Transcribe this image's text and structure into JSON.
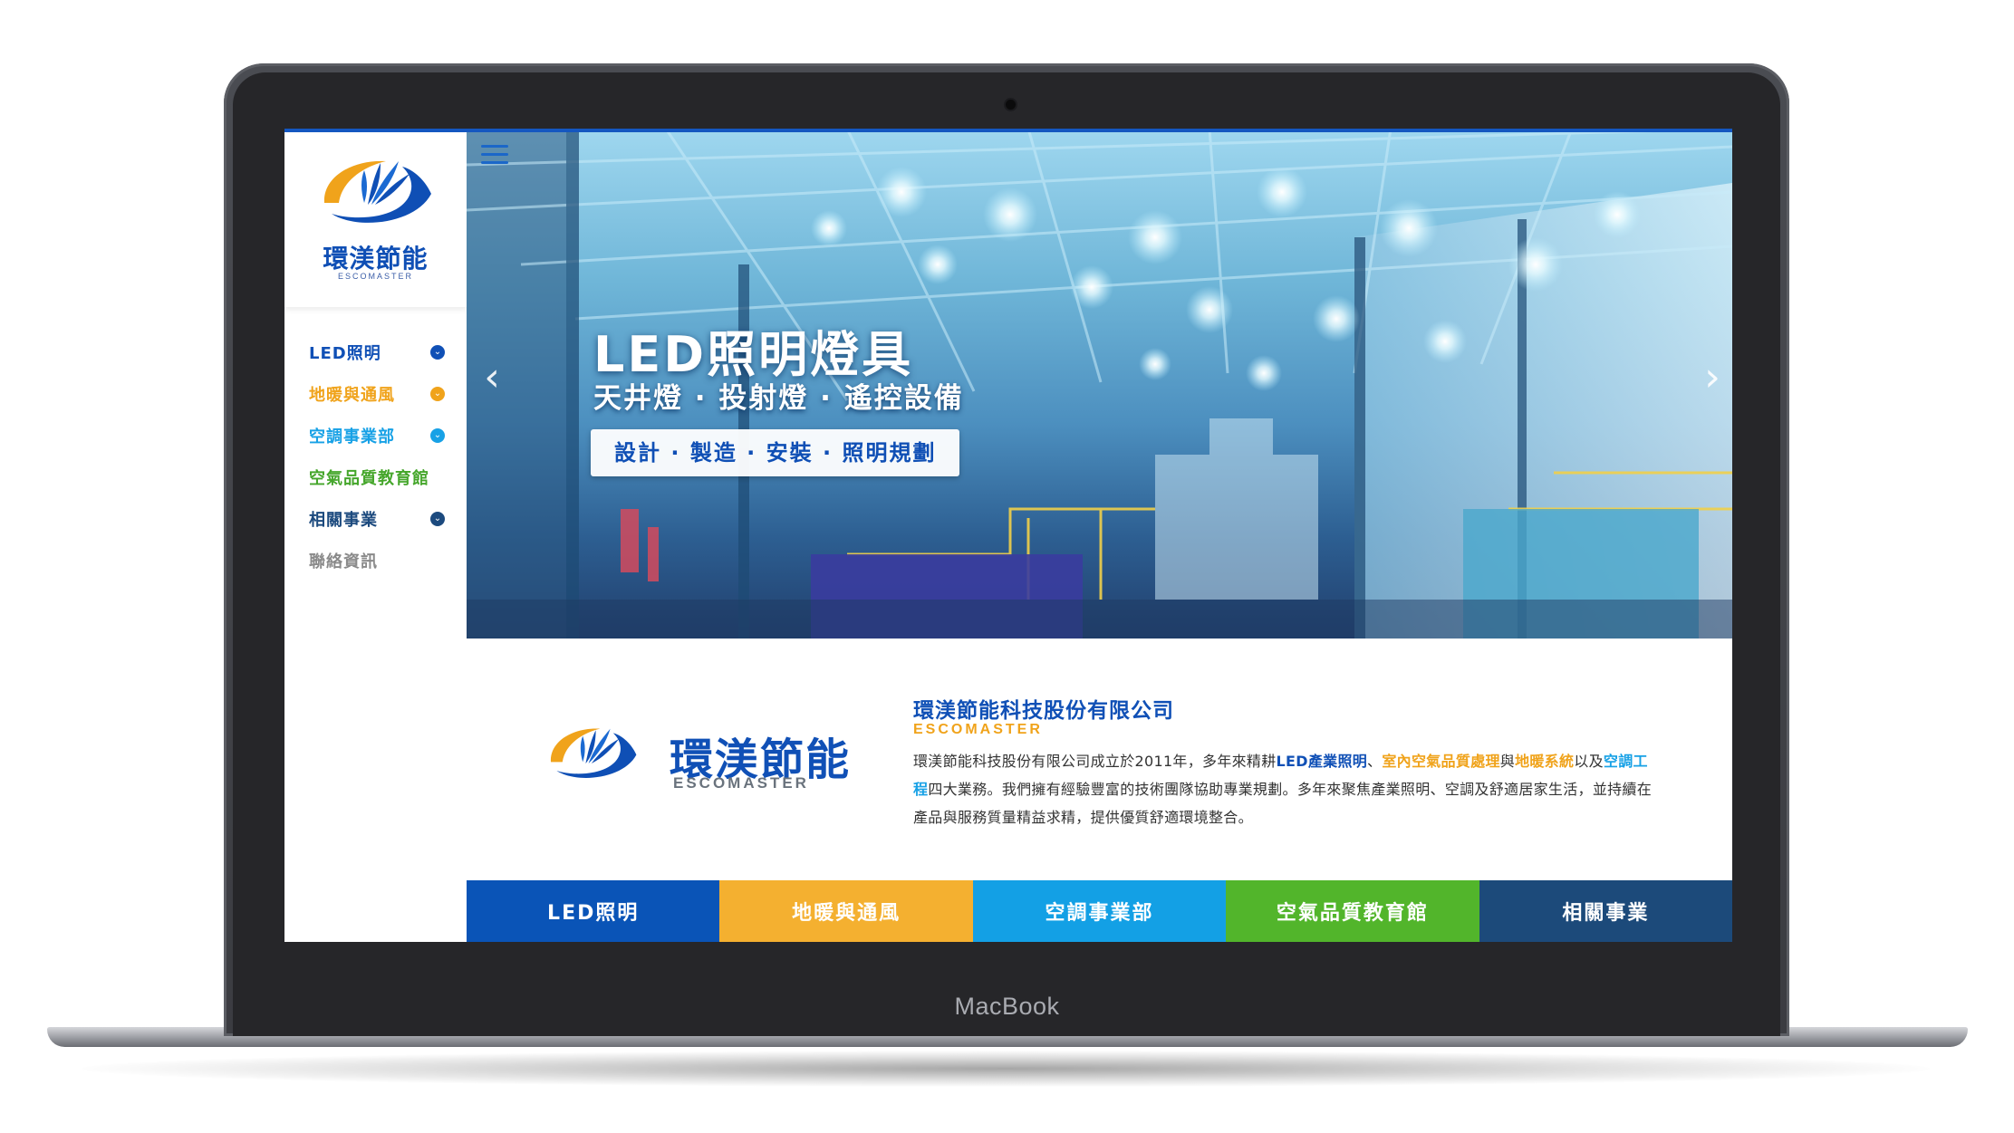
{
  "device": {
    "brand_label": "MacBook"
  },
  "sidebar": {
    "logo": {
      "name_cn": "環渼節能",
      "name_en": "ESCOMASTER"
    },
    "items": [
      {
        "label": "LED照明",
        "color": "#1050b6",
        "has_dropdown": true
      },
      {
        "label": "地暖與通風",
        "color": "#f0a31b",
        "has_dropdown": true
      },
      {
        "label": "空調事業部",
        "color": "#17a1e6",
        "has_dropdown": true
      },
      {
        "label": "空氣品質教育館",
        "color": "#45a62b",
        "has_dropdown": false
      },
      {
        "label": "相關事業",
        "color": "#1c4a7e",
        "has_dropdown": true
      },
      {
        "label": "聯絡資訊",
        "color": "#8a8a8a",
        "has_dropdown": false
      }
    ],
    "dropdown_icon": "chevron-down-icon"
  },
  "hero": {
    "title": "LED照明燈具",
    "subtitle": "天井燈 · 投射燈 · 遙控設備",
    "pill": "設計 · 製造 · 安裝 · 照明規劃",
    "prev_icon": "chevron-left-icon",
    "next_icon": "chevron-right-icon",
    "menu_icon": "hamburger-icon"
  },
  "intro": {
    "logo": {
      "name_cn": "環渼節能",
      "name_en": "ESCOMASTER"
    },
    "company_name": "環渼節能科技股份有限公司",
    "company_en": "ESCOMASTER",
    "desc": {
      "p1": "環渼節能科技股份有限公司成立於2011年，多年來精耕",
      "hl1": "LED產業照明",
      "p2": "、",
      "hl2": "室內空氣品質處理",
      "p3": "與",
      "hl3": "地暖系統",
      "p4": "以及",
      "hl4": "空調工程",
      "p5": "四大業務。我們擁有經驗豐富的技術團隊協助專業規劃。多年來聚焦產業照明、空調及舒適居家生活，並持續在產品與服務質量精益求精，提供優質舒適環境整合。"
    }
  },
  "tabs": [
    {
      "label": "LED照明",
      "color": "#0a54b7"
    },
    {
      "label": "地暖與通風",
      "color": "#f4b030"
    },
    {
      "label": "空調事業部",
      "color": "#13a0e5"
    },
    {
      "label": "空氣品質教育館",
      "color": "#52b52b"
    },
    {
      "label": "相關事業",
      "color": "#1c4a7a"
    }
  ],
  "colors": {
    "brand_blue": "#1050b6",
    "brand_orange": "#f0a31b",
    "brand_cyan": "#17a1e6",
    "brand_green": "#45a62b"
  }
}
